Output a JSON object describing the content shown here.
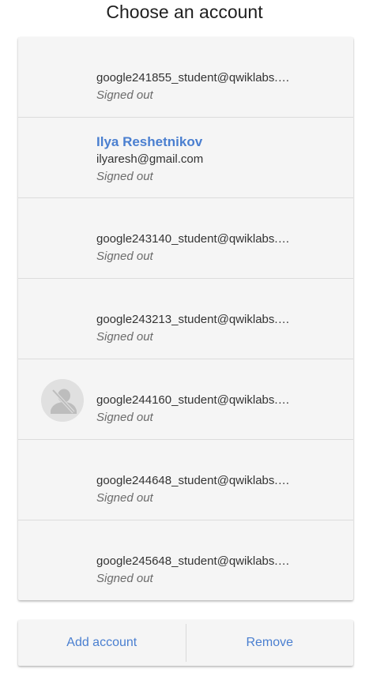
{
  "header": {
    "title": "Choose an account"
  },
  "accounts": [
    {
      "name": "",
      "email": "google241855_student@qwiklabs.…",
      "status": "Signed out",
      "avatar": ""
    },
    {
      "name": "Ilya Reshetnikov",
      "email": "ilyaresh@gmail.com",
      "status": "Signed out",
      "avatar": ""
    },
    {
      "name": "",
      "email": "google243140_student@qwiklabs.…",
      "status": "Signed out",
      "avatar": ""
    },
    {
      "name": "",
      "email": "google243213_student@qwiklabs.…",
      "status": "Signed out",
      "avatar": ""
    },
    {
      "name": "",
      "email": "google244160_student@qwiklabs.…",
      "status": "Signed out",
      "avatar": "no-photo-icon"
    },
    {
      "name": "",
      "email": "google244648_student@qwiklabs.…",
      "status": "Signed out",
      "avatar": ""
    },
    {
      "name": "",
      "email": "google245648_student@qwiklabs.…",
      "status": "Signed out",
      "avatar": ""
    }
  ],
  "actions": {
    "add_label": "Add account",
    "remove_label": "Remove"
  },
  "colors": {
    "accent": "#4a7fd0",
    "card_background": "#f5f5f5",
    "divider": "#dcdcdc"
  }
}
